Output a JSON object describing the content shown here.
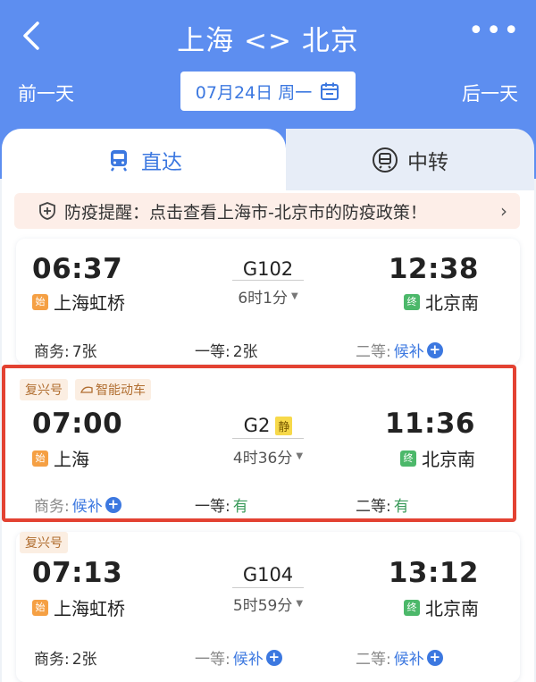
{
  "header": {
    "title": "上海 <> 北京",
    "prev_day": "前一天",
    "next_day": "后一天",
    "date": "07月24日 周一",
    "more": "•••"
  },
  "tabs": [
    {
      "label": "直达",
      "icon": "train-icon",
      "active": true
    },
    {
      "label": "中转",
      "icon": "transfer-icon",
      "active": false
    }
  ],
  "notice": {
    "text": "防疫提醒：点击查看上海市-北京市的防疫政策！",
    "arrow": "›"
  },
  "trains": [
    {
      "tags": [],
      "depart_time": "06:37",
      "depart_badge": "始",
      "depart_station": "上海虹桥",
      "train_no": "G102",
      "quiet_badge": "",
      "duration": "6时1分",
      "arrive_time": "12:38",
      "arrive_badge": "终",
      "arrive_station": "北京南",
      "seats": {
        "business_label": "商务:",
        "business_value": "7张",
        "first_label": "一等:",
        "first_value": "2张",
        "second_label": "二等:",
        "second_value": "候补"
      }
    },
    {
      "tags": [
        "复兴号",
        "智能动车"
      ],
      "depart_time": "07:00",
      "depart_badge": "始",
      "depart_station": "上海",
      "train_no": "G2",
      "quiet_badge": "静",
      "duration": "4时36分",
      "arrive_time": "11:36",
      "arrive_badge": "终",
      "arrive_station": "北京南",
      "seats": {
        "business_label": "商务:",
        "business_value": "候补",
        "first_label": "一等:",
        "first_value": "有",
        "second_label": "二等:",
        "second_value": "有"
      }
    },
    {
      "tags": [
        "复兴号"
      ],
      "depart_time": "07:13",
      "depart_badge": "始",
      "depart_station": "上海虹桥",
      "train_no": "G104",
      "quiet_badge": "",
      "duration": "5时59分",
      "arrive_time": "13:12",
      "arrive_badge": "终",
      "arrive_station": "北京南",
      "seats": {
        "business_label": "商务:",
        "business_value": "2张",
        "first_label": "一等:",
        "first_value": "候补",
        "second_label": "二等:",
        "second_value": "候补"
      }
    }
  ],
  "colors": {
    "header_bg": "#5d8ef0",
    "accent": "#3c78e0",
    "highlight_border": "#e34232",
    "available": "#3a9a5a"
  }
}
